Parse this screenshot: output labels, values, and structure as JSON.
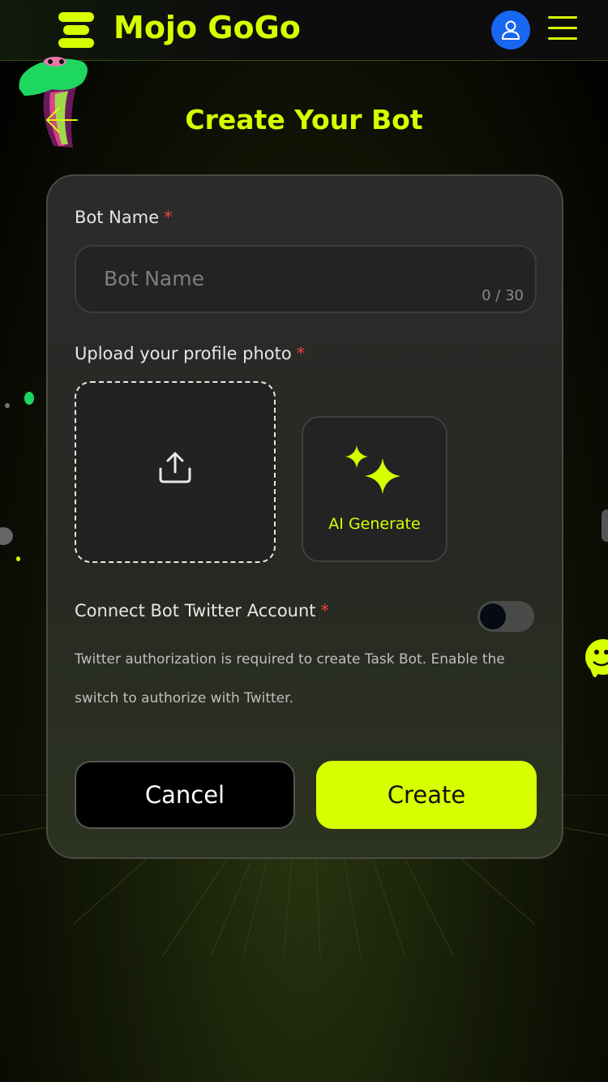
{
  "header": {
    "app_title": "Mojo GoGo",
    "avatar_icon": "user-icon",
    "menu_icon": "hamburger-menu-icon",
    "brand_color": "#d8ff00"
  },
  "page": {
    "title": "Create Your Bot",
    "back_icon": "arrow-left-icon"
  },
  "form": {
    "bot_name": {
      "label": "Bot Name",
      "required_mark": "*",
      "placeholder": "Bot Name",
      "value": "",
      "counter": "0 / 30"
    },
    "profile_photo": {
      "label": "Upload your profile photo",
      "required_mark": "*",
      "upload_icon": "upload-icon",
      "ai_generate_label": "AI Generate",
      "ai_icon": "sparkle-icon"
    },
    "twitter": {
      "label": "Connect Bot Twitter Account",
      "required_mark": "*",
      "enabled": false,
      "description": "Twitter authorization is required to create Task Bot. Enable the switch to authorize with Twitter."
    },
    "buttons": {
      "cancel": "Cancel",
      "create": "Create"
    }
  }
}
